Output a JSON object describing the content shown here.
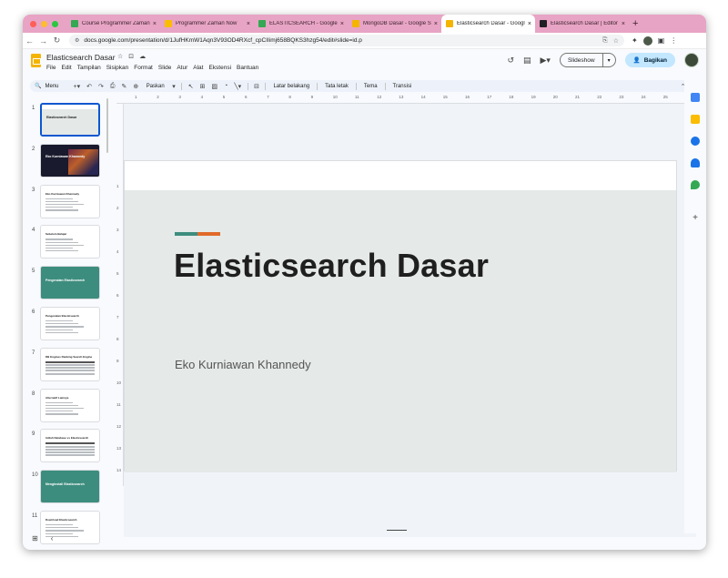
{
  "browser": {
    "tabs": [
      {
        "title": "Course Programmer Zaman No",
        "favicon_color": "#34a853",
        "active": false
      },
      {
        "title": "Programmer Zaman Now",
        "favicon_color": "#fbbc04",
        "active": false
      },
      {
        "title": "ELASTICSEARCH - Google Dri",
        "favicon_color": "#34a853",
        "active": false
      },
      {
        "title": "MongoDB Dasar - Google Slide",
        "favicon_color": "#f4b400",
        "active": false
      },
      {
        "title": "Elasticsearch Dasar - Google",
        "favicon_color": "#f4b400",
        "active": true
      },
      {
        "title": "Elasticsearch Dasar | Editor - Sc",
        "favicon_color": "#202124",
        "active": false
      }
    ],
    "new_tab": "+",
    "url": "docs.google.com/presentation/d/1JufHKmW1Aqn3V93OD4RXcf_cpCIIimj658BQKS3hzg54/edit#slide=id.p"
  },
  "docs": {
    "title": "Elasticsearch Dasar",
    "menus": [
      "File",
      "Edit",
      "Tampilan",
      "Sisipkan",
      "Format",
      "Slide",
      "Atur",
      "Alat",
      "Ekstensi",
      "Bantuan"
    ],
    "slideshow_label": "Slideshow",
    "share_label": "Bagikan"
  },
  "toolbar": {
    "menu_label": "Menu",
    "zoom_label": "Paskan",
    "background_label": "Latar belakang",
    "layout_label": "Tata letak",
    "theme_label": "Tema",
    "transition_label": "Transisi"
  },
  "ruler": {
    "top": [
      "1",
      "2",
      "3",
      "4",
      "5",
      "6",
      "7",
      "8",
      "9",
      "10",
      "11",
      "12",
      "13",
      "14",
      "15",
      "16",
      "17",
      "18",
      "19",
      "20",
      "21",
      "22",
      "23",
      "24",
      "25"
    ],
    "left": [
      "1",
      "2",
      "3",
      "4",
      "5",
      "6",
      "7",
      "8",
      "9",
      "10",
      "11",
      "12",
      "13",
      "14"
    ]
  },
  "slides": [
    {
      "num": "1",
      "kind": "title-selected",
      "text": "Elasticsearch Dasar"
    },
    {
      "num": "2",
      "kind": "dark",
      "text": "Eko Kurniawan Khannedy"
    },
    {
      "num": "3",
      "kind": "list",
      "text": "Eko Kurniawan Khannedy"
    },
    {
      "num": "4",
      "kind": "list",
      "text": "Sebelum Belajar"
    },
    {
      "num": "5",
      "kind": "teal",
      "text": "Pengenalan Elasticsearch"
    },
    {
      "num": "6",
      "kind": "list",
      "text": "Pengenalan Elasticsearch"
    },
    {
      "num": "7",
      "kind": "table",
      "text": "DB Engines Ranking Search Engine"
    },
    {
      "num": "8",
      "kind": "list",
      "text": "Alternatif Lainnya"
    },
    {
      "num": "9",
      "kind": "table",
      "text": "Istilah Database vs Elasticsearch"
    },
    {
      "num": "10",
      "kind": "teal",
      "text": "Menginstall Elasticsearch"
    },
    {
      "num": "11",
      "kind": "list",
      "text": "Download Elasticsearch"
    }
  ],
  "slide": {
    "title": "Elasticsearch Dasar",
    "subtitle": "Eko Kurniawan Khannedy",
    "accent_colors": [
      "#3d8d7e",
      "#e06a2a"
    ]
  },
  "colors": {
    "tab_strip": "#e8a4c4",
    "share_button": "#c2e7ff",
    "selection": "#0b57d0",
    "teal": "#3d8d7e"
  }
}
